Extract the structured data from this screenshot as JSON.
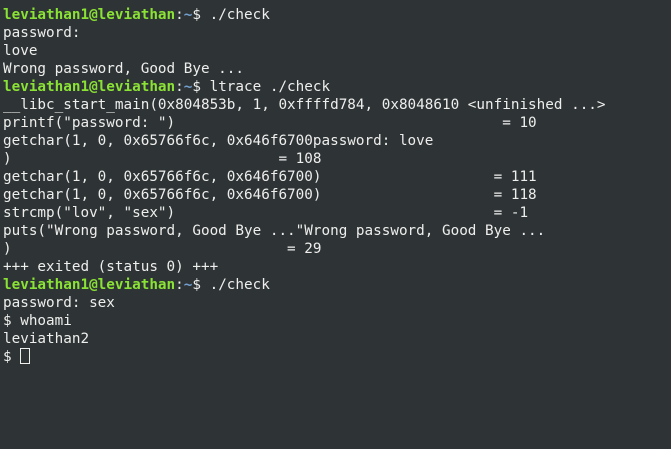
{
  "terminal": {
    "lines": [
      {
        "type": "prompt",
        "user": "leviathan1@leviathan",
        "sep": ":",
        "path": "~",
        "dollar": "$ ",
        "cmd": "./check"
      },
      {
        "type": "output",
        "text": "password:"
      },
      {
        "type": "output",
        "text": "love"
      },
      {
        "type": "output",
        "text": "Wrong password, Good Bye ..."
      },
      {
        "type": "prompt",
        "user": "leviathan1@leviathan",
        "sep": ":",
        "path": "~",
        "dollar": "$ ",
        "cmd": "ltrace ./check"
      },
      {
        "type": "output",
        "text": "__libc_start_main(0x804853b, 1, 0xffffd784, 0x8048610 <unfinished ...>"
      },
      {
        "type": "output",
        "text": "printf(\"password: \")                                      = 10"
      },
      {
        "type": "output",
        "text": "getchar(1, 0, 0x65766f6c, 0x646f6700password: love"
      },
      {
        "type": "output",
        "text": ")                               = 108"
      },
      {
        "type": "output",
        "text": "getchar(1, 0, 0x65766f6c, 0x646f6700)                    = 111"
      },
      {
        "type": "output",
        "text": "getchar(1, 0, 0x65766f6c, 0x646f6700)                    = 118"
      },
      {
        "type": "output",
        "text": "strcmp(\"lov\", \"sex\")                                     = -1"
      },
      {
        "type": "output",
        "text": "puts(\"Wrong password, Good Bye ...\"Wrong password, Good Bye ..."
      },
      {
        "type": "output",
        "text": ")                                = 29"
      },
      {
        "type": "output",
        "text": "+++ exited (status 0) +++"
      },
      {
        "type": "prompt",
        "user": "leviathan1@leviathan",
        "sep": ":",
        "path": "~",
        "dollar": "$ ",
        "cmd": "./check"
      },
      {
        "type": "output",
        "text": "password: sex"
      },
      {
        "type": "output",
        "text": "$ whoami"
      },
      {
        "type": "output",
        "text": "leviathan2"
      },
      {
        "type": "cursor",
        "text": "$ "
      }
    ]
  },
  "colors": {
    "background": "#2e3436",
    "text": "#eeeeec",
    "user": "#8ae234",
    "path": "#729fcf"
  }
}
